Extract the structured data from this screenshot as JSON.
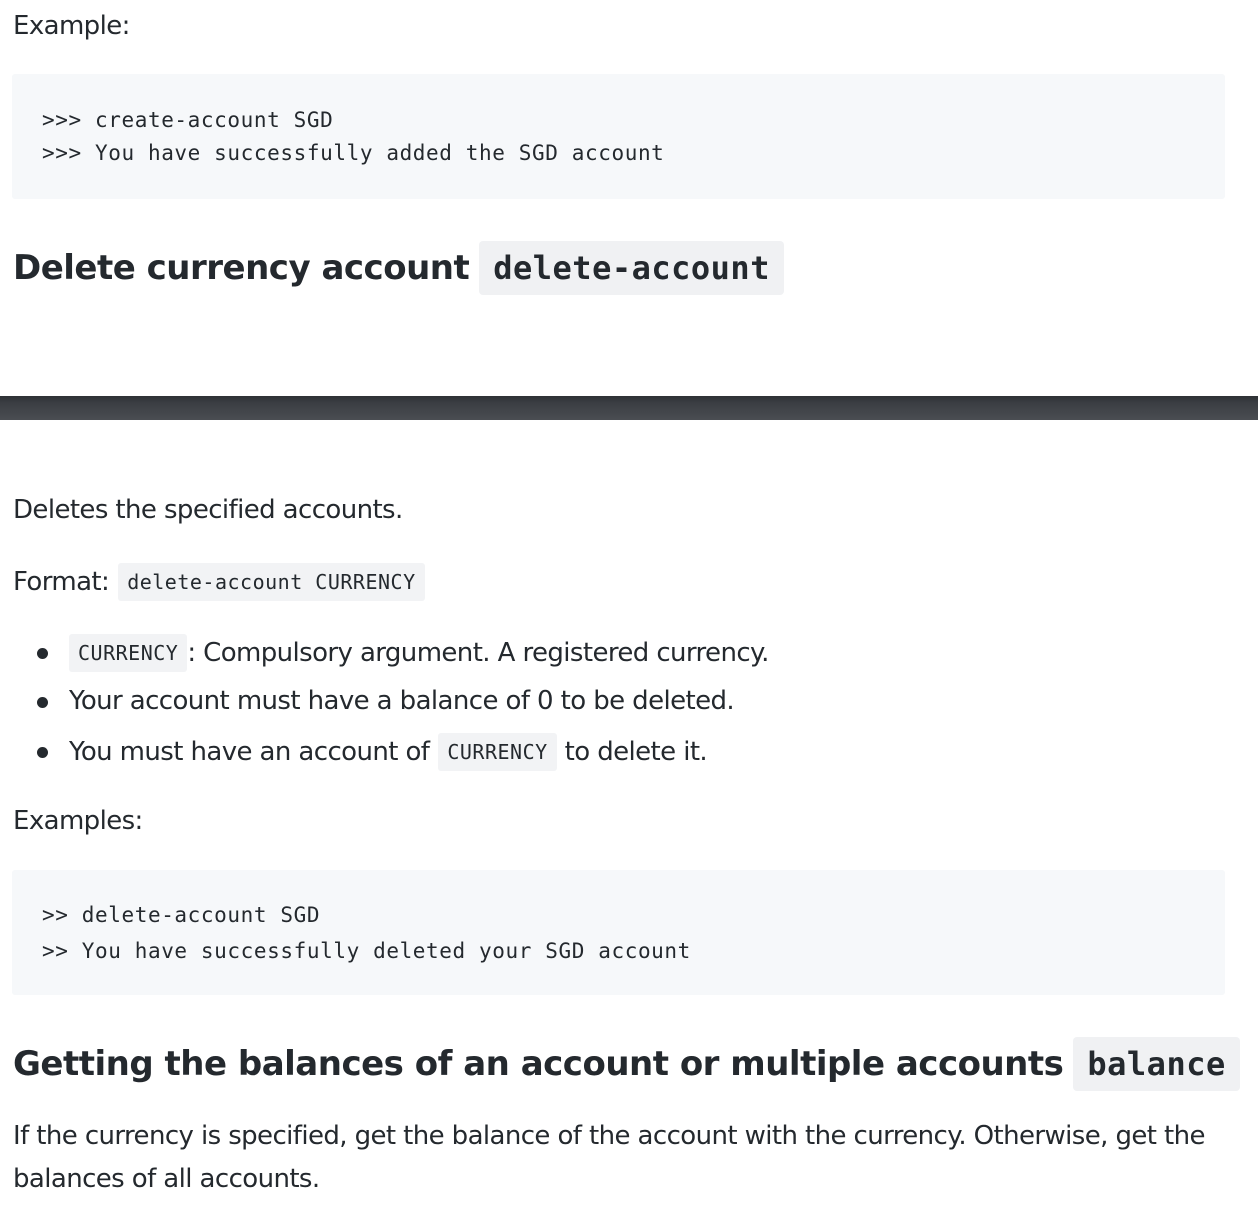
{
  "section_create": {
    "example_label": "Example:",
    "example_lines": [
      ">>> create-account SGD",
      ">>> You have successfully added the SGD account"
    ]
  },
  "section_delete": {
    "heading_text": "Delete currency account",
    "heading_code": "delete-account",
    "description": "Deletes the specified accounts.",
    "format_label": "Format:",
    "format_code": "delete-account CURRENCY",
    "bullets": [
      {
        "code": "CURRENCY",
        "text": ": Compulsory argument. A registered currency."
      },
      {
        "text": "Your account must have a balance of 0 to be deleted."
      },
      {
        "text_before": "You must have an account of",
        "code": "CURRENCY",
        "text_after": "to delete it."
      }
    ],
    "examples_label": "Examples:",
    "example_lines": [
      ">> delete-account SGD",
      ">> You have successfully deleted your SGD account"
    ]
  },
  "section_balance": {
    "heading_text": "Getting the balances of an account or multiple accounts",
    "heading_code": "balance",
    "description_line1": "If the currency is specified, get the balance of the account with the currency. Otherwise, get the",
    "description_line2": "balances of all accounts."
  }
}
